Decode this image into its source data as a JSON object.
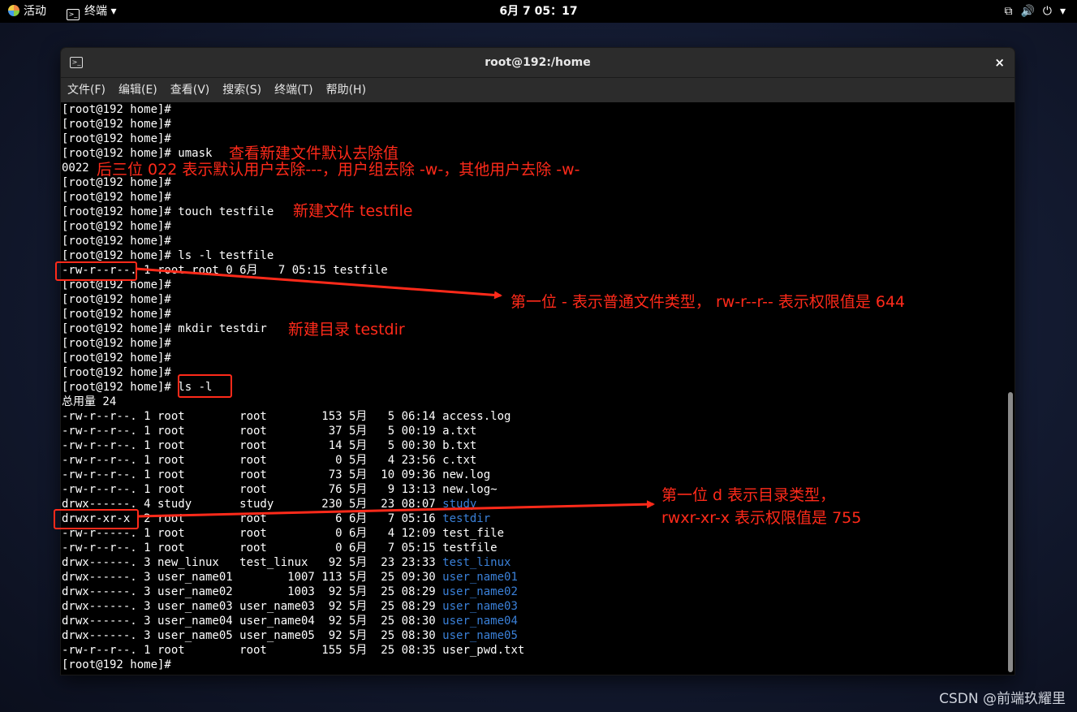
{
  "topbar": {
    "activities": "活动",
    "app_name": "终端",
    "clock": "6月 7  05：17"
  },
  "window": {
    "title": "root@192:/home",
    "close_glyph": "×"
  },
  "menu": [
    "文件(F)",
    "编辑(E)",
    "查看(V)",
    "搜索(S)",
    "终端(T)",
    "帮助(H)"
  ],
  "terminal_lines": [
    {
      "text": "[root@192 home]#"
    },
    {
      "text": "[root@192 home]#"
    },
    {
      "text": "[root@192 home]#"
    },
    {
      "text": "[root@192 home]# umask"
    },
    {
      "text": "0022"
    },
    {
      "text": "[root@192 home]#"
    },
    {
      "text": "[root@192 home]#"
    },
    {
      "text": "[root@192 home]# touch testfile"
    },
    {
      "text": "[root@192 home]#"
    },
    {
      "text": "[root@192 home]#"
    },
    {
      "text": "[root@192 home]# ls -l testfile"
    },
    {
      "text": "-rw-r--r--. 1 root root 0 6月   7 05:15 testfile"
    },
    {
      "text": "[root@192 home]#"
    },
    {
      "text": "[root@192 home]#"
    },
    {
      "text": "[root@192 home]#"
    },
    {
      "text": "[root@192 home]# mkdir testdir"
    },
    {
      "text": "[root@192 home]#"
    },
    {
      "text": "[root@192 home]#"
    },
    {
      "text": "[root@192 home]#"
    },
    {
      "text": "[root@192 home]# ls -l"
    },
    {
      "text": "总用量 24"
    },
    {
      "text": "-rw-r--r--. 1 root        root        153 5月   5 06:14 ",
      "name": "access.log"
    },
    {
      "text": "-rw-r--r--. 1 root        root         37 5月   5 00:19 ",
      "name": "a.txt"
    },
    {
      "text": "-rw-r--r--. 1 root        root         14 5月   5 00:30 ",
      "name": "b.txt"
    },
    {
      "text": "-rw-r--r--. 1 root        root          0 5月   4 23:56 ",
      "name": "c.txt"
    },
    {
      "text": "-rw-r--r--. 1 root        root         73 5月  10 09:36 ",
      "name": "new.log"
    },
    {
      "text": "-rw-r--r--. 1 root        root         76 5月   9 13:13 ",
      "name": "new.log~"
    },
    {
      "text": "drwx------. 4 study       study       230 5月  23 08:07 ",
      "name": "study",
      "dir": true
    },
    {
      "text": "drwxr-xr-x  2 root        root          6 6月   7 05:16 ",
      "name": "testdir",
      "dir": true
    },
    {
      "text": "-rw-r-----. 1 root        root          0 6月   4 12:09 ",
      "name": "test_file"
    },
    {
      "text": "-rw-r--r--. 1 root        root          0 6月   7 05:15 ",
      "name": "testfile"
    },
    {
      "text": "drwx------. 3 new_linux   test_linux   92 5月  23 23:33 ",
      "name": "test_linux",
      "dir": true
    },
    {
      "text": "drwx------. 3 user_name01        1007 113 5月  25 09:30 ",
      "name": "user_name01",
      "dir": true
    },
    {
      "text": "drwx------. 3 user_name02        1003  92 5月  25 08:29 ",
      "name": "user_name02",
      "dir": true
    },
    {
      "text": "drwx------. 3 user_name03 user_name03  92 5月  25 08:29 ",
      "name": "user_name03",
      "dir": true
    },
    {
      "text": "drwx------. 3 user_name04 user_name04  92 5月  25 08:30 ",
      "name": "user_name04",
      "dir": true
    },
    {
      "text": "drwx------. 3 user_name05 user_name05  92 5月  25 08:30 ",
      "name": "user_name05",
      "dir": true
    },
    {
      "text": "-rw-r--r--. 1 root        root        155 5月  25 08:35 ",
      "name": "user_pwd.txt"
    },
    {
      "text": "[root@192 home]#"
    }
  ],
  "annotations": {
    "umask_note": "查看新建文件默认去除值",
    "mask_note": "后三位 022 表示默认用户去除---，用户组去除 -w-，其他用户去除 -w-",
    "touch_note": "新建文件 testfile",
    "file_note": "第一位 - 表示普通文件类型，  rw-r--r-- 表示权限值是 644",
    "mkdir_note": "新建目录 testdir",
    "dir_note_line1": "第一位 d 表示目录类型，",
    "dir_note_line2": "rwxr-xr-x 表示权限值是 755",
    "color": "#ff2a1a"
  },
  "watermark": "CSDN @前端玖耀里",
  "colors": {
    "terminal_bg": "#000000",
    "terminal_fg": "#ffffff",
    "directory": "#3a80d8",
    "titlebar": "#2c2c2c"
  }
}
